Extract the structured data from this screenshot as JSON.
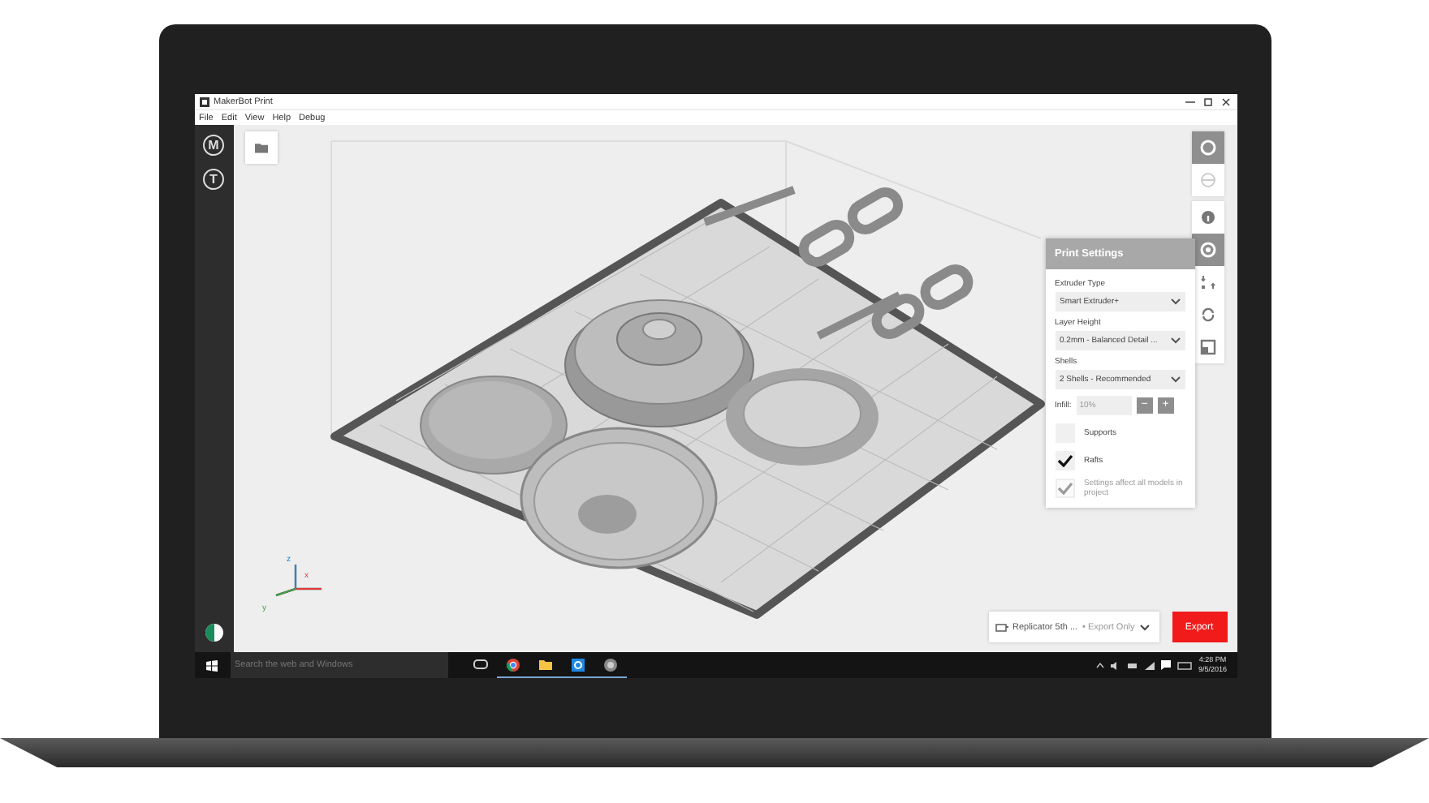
{
  "window": {
    "title": "MakerBot Print"
  },
  "menu": [
    "File",
    "Edit",
    "View",
    "Help",
    "Debug"
  ],
  "sidebar": [
    {
      "letter": "M"
    },
    {
      "letter": "T"
    }
  ],
  "view_tools": [
    {
      "kind": "solid",
      "selected": true
    },
    {
      "kind": "wire",
      "selected": false
    }
  ],
  "tools": [
    {
      "kind": "info",
      "selected": false
    },
    {
      "kind": "settings",
      "selected": true
    },
    {
      "kind": "move",
      "selected": false
    },
    {
      "kind": "rotate",
      "selected": false
    },
    {
      "kind": "scale",
      "selected": false
    }
  ],
  "print_settings": {
    "title": "Print Settings",
    "fields": [
      {
        "label": "Extruder Type",
        "value": "Smart Extruder+"
      },
      {
        "label": "Layer Height",
        "value": "0.2mm - Balanced Detail ..."
      },
      {
        "label": "Shells",
        "value": "2 Shells - Recommended"
      }
    ],
    "infill": {
      "label": "Infill:",
      "value": "10%",
      "buttons": [
        "−",
        "+"
      ]
    },
    "checkboxes": [
      {
        "label": "Supports",
        "checked": false,
        "disabled": false
      },
      {
        "label": "Rafts",
        "checked": true,
        "disabled": false
      },
      {
        "label": "Settings affect all models in project",
        "checked": true,
        "disabled": true
      }
    ]
  },
  "axes": [
    "x",
    "y",
    "z"
  ],
  "printer": {
    "name": "Replicator 5th ...",
    "mode": "• Export Only"
  },
  "export_button": "Export",
  "taskbar": {
    "search": {
      "placeholder": "Search the web and Windows"
    },
    "time": "4:28 PM",
    "date": "9/5/2016"
  }
}
